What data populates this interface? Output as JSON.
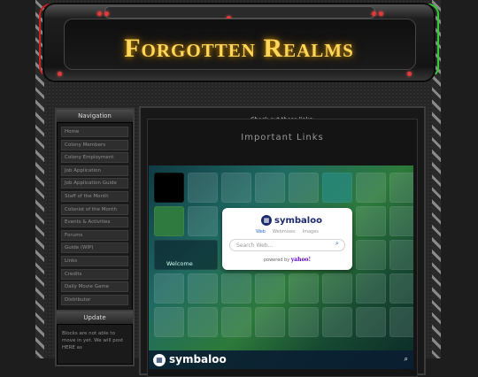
{
  "site": {
    "title": "Forgotten Realms"
  },
  "sidebar": {
    "nav_title": "Navigation",
    "items": [
      {
        "label": "Home"
      },
      {
        "label": "Colony Members"
      },
      {
        "label": "Colony Employment"
      },
      {
        "label": "Job Application"
      },
      {
        "label": "Job Application Guide"
      },
      {
        "label": "Staff of the Month"
      },
      {
        "label": "Colonist of the Month"
      },
      {
        "label": "Events & Activities"
      },
      {
        "label": "Forums"
      },
      {
        "label": "Guide (WIP)"
      },
      {
        "label": "Links"
      },
      {
        "label": "Credits"
      },
      {
        "label": "Daily Movie Game"
      },
      {
        "label": "Distributor"
      }
    ],
    "update_title": "Update",
    "update_text": "Blocks are not able to move in yet. We will post HERE as"
  },
  "main": {
    "top_text": "Check out these links:",
    "heading": "Important Links"
  },
  "symbaloo": {
    "brand": "symbaloo",
    "tabs": [
      "Web",
      "Webmixes",
      "Images"
    ],
    "search_placeholder": "Search Web...",
    "powered_by": "powered by",
    "yahoo": "yahoo!",
    "welcome": "Welcome",
    "footer_brand": "symbaloo"
  },
  "colors": {
    "title_glow": "#ffd65a",
    "accent_red": "#e13a3a",
    "symbaloo_blue": "#1b2a6b"
  }
}
